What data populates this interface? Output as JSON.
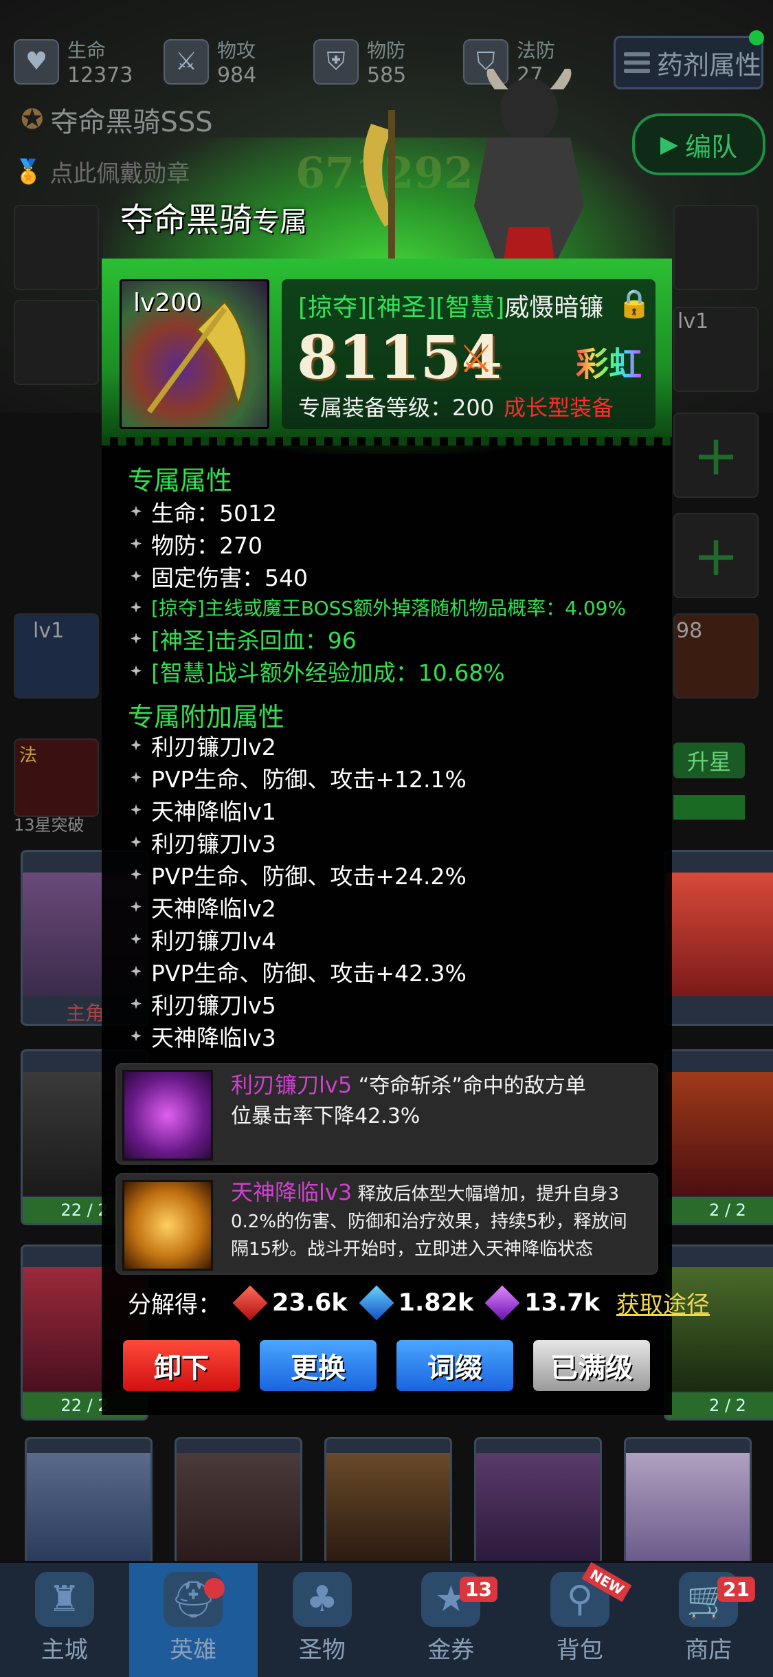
{
  "stats": [
    {
      "label": "生命",
      "value": "12373",
      "icon": "heart-icon"
    },
    {
      "label": "物攻",
      "value": "984",
      "icon": "sword-icon"
    },
    {
      "label": "物防",
      "value": "585",
      "icon": "shield-icon"
    },
    {
      "label": "法防",
      "value": "27",
      "icon": "magic-shield-icon"
    }
  ],
  "potion_button": "药剂属性",
  "team_button": "编队",
  "hero_name": "夺命黑骑SSS",
  "badge_prompt": "点此佩戴勋章",
  "hero_power_bg": "671292",
  "side_levels": {
    "left": "lv1",
    "right": "lv1",
    "right2": "98"
  },
  "side_labels": {
    "fa": "法",
    "break": "13星突破",
    "upgrade": "升星",
    "main_role": "主角"
  },
  "card_counts": [
    "22 / 2",
    "22 / 2",
    "2 / 2",
    "2 / 2"
  ],
  "modal": {
    "title": "夺命黑骑",
    "title_suffix": "专属",
    "item_level": "lv200",
    "tags": "[掠夺][神圣][智慧]",
    "item_name": "威慑暗镰",
    "power": "81154",
    "quality": "彩虹",
    "equip_level_label": "专属装备等级：200",
    "growth_label": "成长型装备",
    "exclusive_attrs_title": "专属属性",
    "exclusive_attrs": [
      {
        "text": "生命：5012",
        "style": "white"
      },
      {
        "text": "物防：270",
        "style": "white"
      },
      {
        "text": "固定伤害：540",
        "style": "white"
      },
      {
        "text": "[掠夺]主线或魔王BOSS额外掉落随机物品概率：4.09%",
        "style": "green-sm"
      },
      {
        "text": "[神圣]击杀回血：96",
        "style": "green"
      },
      {
        "text": "[智慧]战斗额外经验加成：10.68%",
        "style": "green"
      }
    ],
    "extra_attrs_title": "专属附加属性",
    "extra_attrs": [
      "利刃镰刀lv2",
      "PVP生命、防御、攻击+12.1%",
      "天神降临lv1",
      "利刃镰刀lv3",
      "PVP生命、防御、攻击+24.2%",
      "天神降临lv2",
      "利刃镰刀lv4",
      "PVP生命、防御、攻击+42.3%",
      "利刃镰刀lv5",
      "天神降临lv3"
    ],
    "skills": [
      {
        "name": "利刃镰刀lv5",
        "desc_line1": " “夺命斩杀”命中的敌方单",
        "desc_line2": "位暴击率下降42.3%"
      },
      {
        "name": "天神降临lv3",
        "desc_line1": " 释放后体型大幅增加，提升自身3",
        "desc_line2": "0.2%的伤害、防御和治疗效果，持续5秒，释放间",
        "desc_line3": "隔15秒。战斗开始时，立即进入天神降临状态"
      }
    ],
    "decompose_label": "分解得：",
    "decompose": [
      {
        "value": "23.6k",
        "gem": "red"
      },
      {
        "value": "1.82k",
        "gem": "blue"
      },
      {
        "value": "13.7k",
        "gem": "purple"
      }
    ],
    "obtain_link": "获取途径",
    "buttons": [
      "卸下",
      "更换",
      "词缀",
      "已满级"
    ]
  },
  "nav": [
    {
      "label": "主城",
      "icon": "castle-icon"
    },
    {
      "label": "英雄",
      "icon": "helmet-icon"
    },
    {
      "label": "圣物",
      "icon": "clover-icon"
    },
    {
      "label": "金券",
      "icon": "ticket-icon",
      "badge": "13"
    },
    {
      "label": "背包",
      "icon": "bag-icon",
      "tag": "NEW"
    },
    {
      "label": "商店",
      "icon": "cart-icon",
      "badge": "21"
    }
  ],
  "colors": {
    "accent_green": "#30e050",
    "growth_red": "#ff2b2b",
    "link_yellow": "#f0d84a",
    "skill_purple": "#d040d0"
  }
}
